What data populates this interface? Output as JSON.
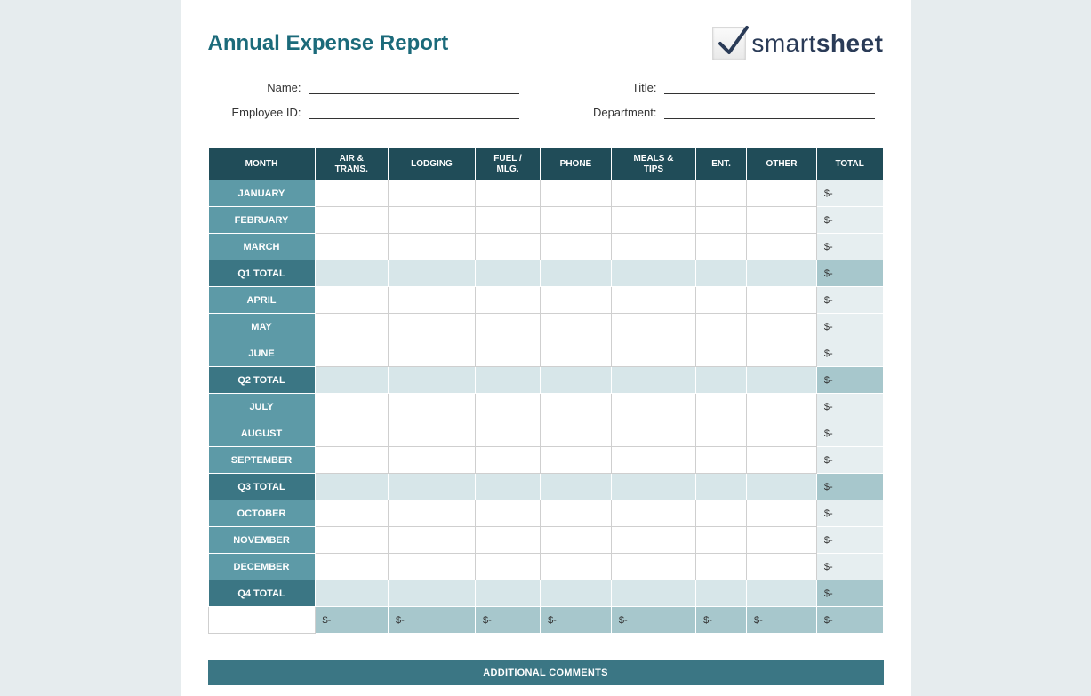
{
  "report_title": "Annual Expense Report",
  "brand": {
    "part1": "smart",
    "part2": "sheet"
  },
  "fields": {
    "name_label": "Name:",
    "title_label": "Title:",
    "employee_id_label": "Employee ID:",
    "department_label": "Department:"
  },
  "headers": [
    "MONTH",
    "AIR & TRANS.",
    "LODGING",
    "FUEL / MLG.",
    "PHONE",
    "MEALS & TIPS",
    "ENT.",
    "OTHER",
    "TOTAL"
  ],
  "dash": "$-",
  "rows": [
    {
      "label": "JANUARY",
      "type": "month",
      "total": "$-"
    },
    {
      "label": "FEBRUARY",
      "type": "month",
      "total": "$-"
    },
    {
      "label": "MARCH",
      "type": "month",
      "total": "$-"
    },
    {
      "label": "Q1 TOTAL",
      "type": "quarter",
      "total": "$-"
    },
    {
      "label": "APRIL",
      "type": "month",
      "total": "$-"
    },
    {
      "label": "MAY",
      "type": "month",
      "total": "$-"
    },
    {
      "label": "JUNE",
      "type": "month",
      "total": "$-"
    },
    {
      "label": "Q2 TOTAL",
      "type": "quarter",
      "total": "$-"
    },
    {
      "label": "JULY",
      "type": "month",
      "total": "$-"
    },
    {
      "label": "AUGUST",
      "type": "month",
      "total": "$-"
    },
    {
      "label": "SEPTEMBER",
      "type": "month",
      "total": "$-"
    },
    {
      "label": "Q3 TOTAL",
      "type": "quarter",
      "total": "$-"
    },
    {
      "label": "OCTOBER",
      "type": "month",
      "total": "$-"
    },
    {
      "label": "NOVEMBER",
      "type": "month",
      "total": "$-"
    },
    {
      "label": "DECEMBER",
      "type": "month",
      "total": "$-"
    },
    {
      "label": "Q4 TOTAL",
      "type": "quarter",
      "total": "$-"
    }
  ],
  "comments_header": "ADDITIONAL COMMENTS"
}
